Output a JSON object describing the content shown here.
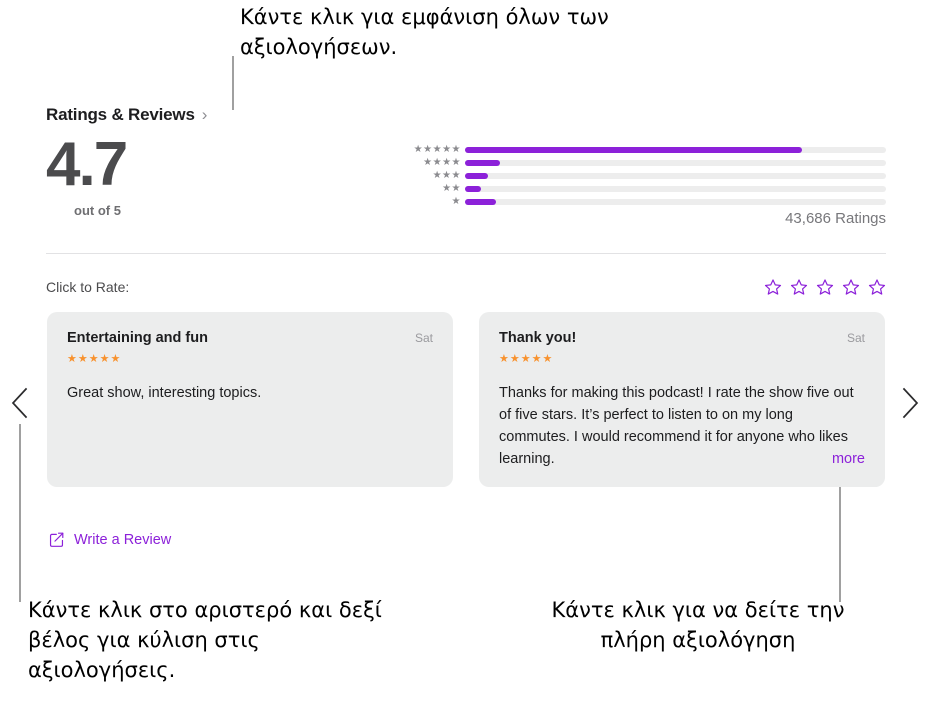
{
  "annotations": {
    "top": "Κάντε κλικ για εμφάνιση όλων των αξιολογήσεων.",
    "bottom_left": "Κάντε κλικ στο αριστερό και δεξί βέλος για κύλιση στις αξιολογήσεις.",
    "bottom_right": "Κάντε κλικ για να δείτε την πλήρη αξιολόγηση"
  },
  "section": {
    "title": "Ratings & Reviews",
    "chevron": "chevron-right-icon",
    "chevron_glyph": "›"
  },
  "summary": {
    "score": "4.7",
    "out_of": "out of 5",
    "ratings_count": "43,686 Ratings"
  },
  "rate": {
    "label": "Click to Rate:",
    "star_count": 5,
    "stars_filled": 0
  },
  "reviews": [
    {
      "title": "Entertaining and fun",
      "date": "Sat",
      "stars": "★★★★★",
      "rating": 5,
      "body": "Great show, interesting topics.",
      "truncated": false,
      "more_label": ""
    },
    {
      "title": "Thank you!",
      "date": "Sat",
      "stars": "★★★★★",
      "rating": 5,
      "body": "Thanks for making this podcast! I rate the show five out of five stars. It’s perfect to listen to on my long commutes. I would recommend it for anyone who likes learning.",
      "truncated": true,
      "more_label": "more"
    }
  ],
  "nav": {
    "prev": "chevron-left-icon",
    "next": "chevron-right-icon"
  },
  "write_review": {
    "icon": "compose-icon",
    "label": "Write a Review"
  },
  "colors": {
    "accent_purple": "#8c21d9",
    "star_orange": "#f8922e",
    "card_bg": "#eceded",
    "track_gray": "#ededed"
  },
  "chart_data": {
    "type": "bar",
    "title": "Rating distribution",
    "orientation": "horizontal",
    "categories": [
      "5 stars",
      "4 stars",
      "3 stars",
      "2 stars",
      "1 star"
    ],
    "star_labels": [
      "★★★★★",
      "★★★★",
      "★★★",
      "★★",
      "★"
    ],
    "values": [
      80,
      8.4,
      5.5,
      3.8,
      7.4
    ],
    "xlabel": "",
    "ylabel": "",
    "xlim": [
      0,
      100
    ],
    "grid": false,
    "legend": false,
    "bar_color": "#8c21d9",
    "track_color": "#ededed",
    "total_label": "43,686 Ratings",
    "average": 4.7
  }
}
